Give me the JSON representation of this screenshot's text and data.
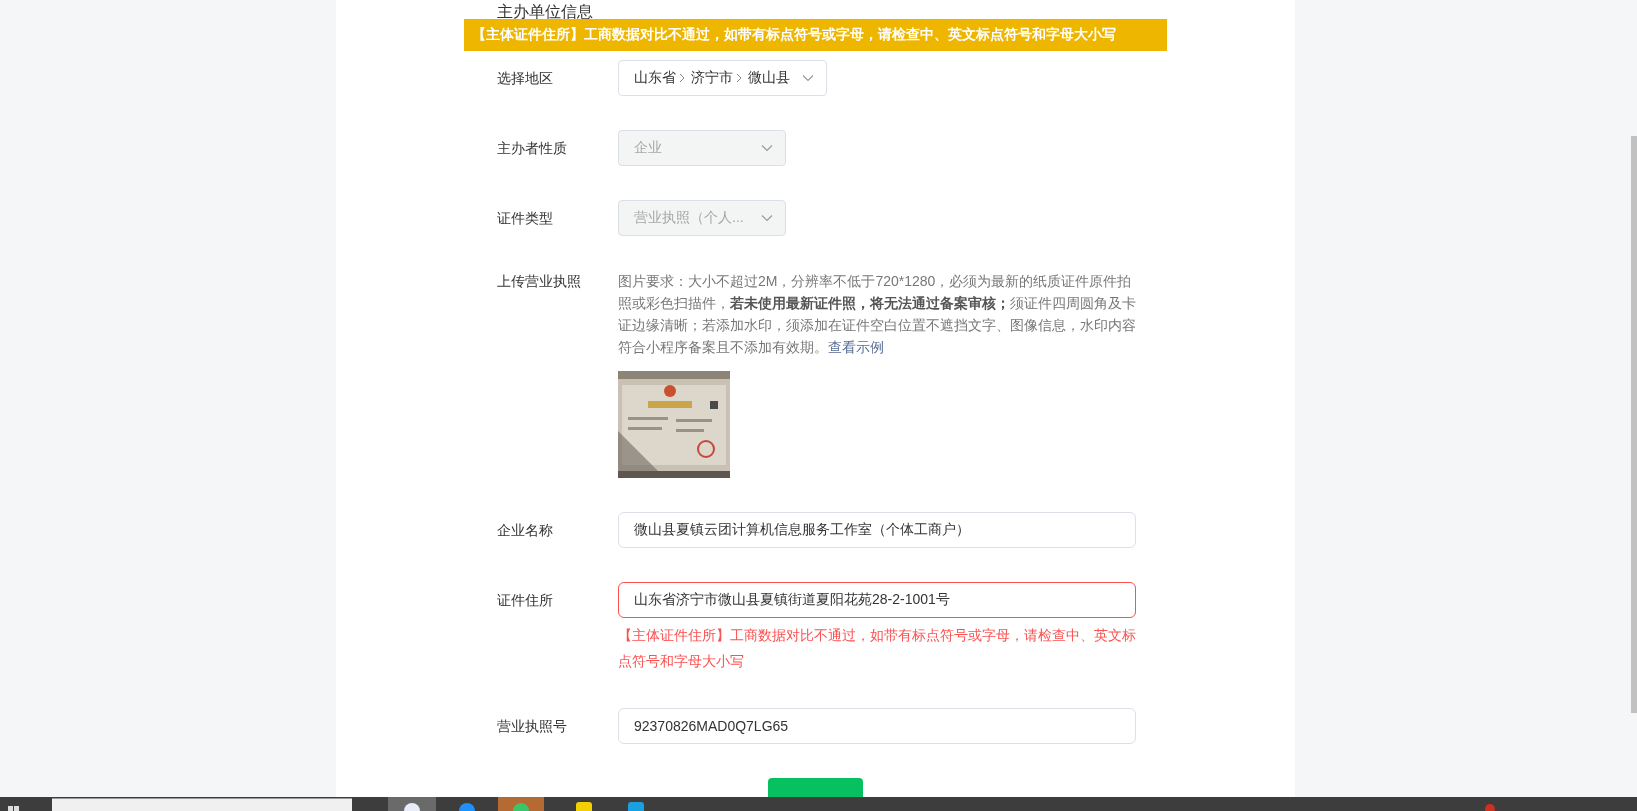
{
  "section_title": "主办单位信息",
  "toast": {
    "text": "【主体证件住所】工商数据对比不通过，如带有标点符号或字母，请检查中、英文标点符号和字母大小写"
  },
  "fields": [
    {
      "kind": "cascader",
      "label": "选择地区",
      "parts": [
        "山东省",
        "济宁市",
        "微山县"
      ],
      "disabled": false
    },
    {
      "kind": "select",
      "label": "主办者性质",
      "value": "企业",
      "disabled": true
    },
    {
      "kind": "select",
      "label": "证件类型",
      "value": "营业执照（个人...",
      "disabled": true
    },
    {
      "kind": "upload",
      "label": "上传营业执照",
      "hint": "图片要求：大小不超过2M，分辨率不低于720*1280，必须为最新的纸质证件原件拍照或彩色扫描件，**若未使用最新证件照，将无法通过备案审核；**须证件四周圆角及卡证边缘清晰；若添加水印，须添加在证件空白位置不遮挡文字、图像信息，水印内容符合小程序备案且不添加有效期。",
      "link": "查看示例"
    },
    {
      "kind": "input",
      "label": "企业名称",
      "value": "微山县夏镇云团计算机信息服务工作室（个体工商户）",
      "error": false
    },
    {
      "kind": "input",
      "label": "证件住所",
      "value": "山东省济宁市微山县夏镇街道夏阳花苑28-2-1001号",
      "error": true,
      "error_text": "【主体证件住所】工商数据对比不通过，如带有标点符号或字母，请检查中、英文标点符号和字母大小写"
    },
    {
      "kind": "input",
      "label": "营业执照号",
      "value": "92370826MAD0Q7LG65",
      "error": false
    }
  ]
}
